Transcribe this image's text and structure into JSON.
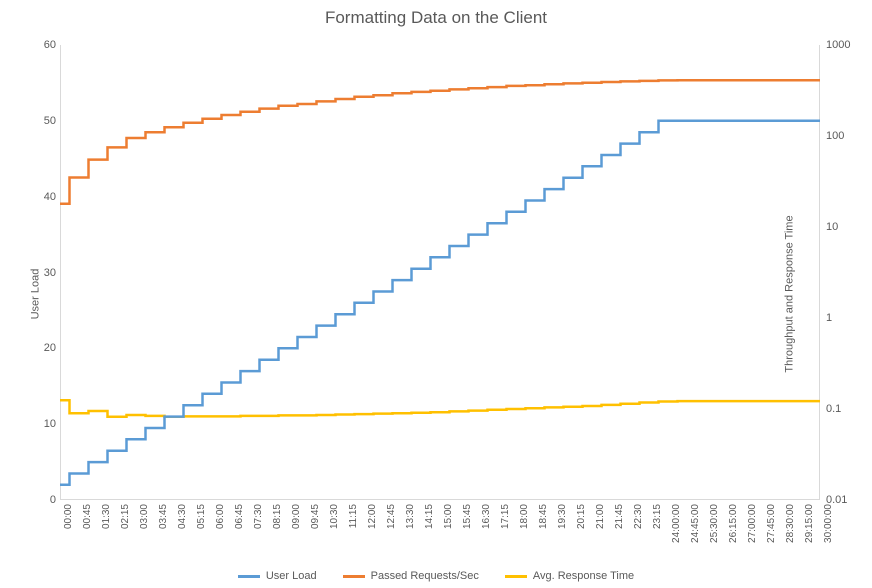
{
  "title": "Formatting Data on the Client",
  "ylabel_left": "User Load",
  "ylabel_right": "Throughput and Response Time",
  "legend": {
    "user_load": "User Load",
    "passed": "Passed Requests/Sec",
    "response": "Avg. Response Time"
  },
  "colors": {
    "user_load": "#5b9bd5",
    "passed": "#ed7d31",
    "response": "#ffc000"
  },
  "left_axis": {
    "min": 0,
    "max": 60,
    "ticks": [
      0,
      10,
      20,
      30,
      40,
      50,
      60
    ]
  },
  "right_axis": {
    "type": "log",
    "min": 0.01,
    "max": 1000,
    "ticks": [
      0.01,
      0.1,
      1,
      10,
      100,
      1000
    ]
  },
  "chart_data": {
    "type": "line",
    "xlabel": "",
    "ylabel": "User Load",
    "ylabel2": "Throughput and Response Time",
    "ylim": [
      0,
      60
    ],
    "ylim2": [
      0.01,
      1000
    ],
    "categories": [
      "00:00",
      "00:45",
      "01:30",
      "02:15",
      "03:00",
      "03:45",
      "04:30",
      "05:15",
      "06:00",
      "06:45",
      "07:30",
      "08:15",
      "09:00",
      "09:45",
      "10:30",
      "11:15",
      "12:00",
      "12:45",
      "13:30",
      "14:15",
      "15:00",
      "15:45",
      "16:30",
      "17:15",
      "18:00",
      "18:45",
      "19:30",
      "20:15",
      "21:00",
      "21:45",
      "22:30",
      "23:15",
      "24:00:00",
      "24:45:00",
      "25:30:00",
      "26:15:00",
      "27:00:00",
      "27:45:00",
      "28:30:00",
      "29:15:00",
      "30:00:00"
    ],
    "series": [
      {
        "name": "User Load",
        "axis": "left",
        "values": [
          2,
          3.5,
          5,
          6.5,
          8,
          9.5,
          11,
          12.5,
          14,
          15.5,
          17,
          18.5,
          20,
          21.5,
          23,
          24.5,
          26,
          27.5,
          29,
          30.5,
          32,
          33.5,
          35,
          36.5,
          38,
          39.5,
          41,
          42.5,
          44,
          45.5,
          47,
          48.5,
          50,
          50,
          50,
          50,
          50,
          50,
          50,
          50,
          50
        ]
      },
      {
        "name": "Passed Requests/Sec",
        "axis": "right",
        "values": [
          18,
          35,
          55,
          75,
          95,
          110,
          125,
          140,
          155,
          170,
          185,
          200,
          215,
          225,
          240,
          255,
          270,
          280,
          295,
          305,
          315,
          325,
          335,
          345,
          355,
          362,
          370,
          378,
          385,
          392,
          398,
          403,
          408,
          410,
          410,
          410,
          410,
          410,
          410,
          410,
          410
        ]
      },
      {
        "name": "Avg. Response Time",
        "axis": "right",
        "values": [
          0.125,
          0.09,
          0.095,
          0.082,
          0.086,
          0.084,
          0.082,
          0.083,
          0.083,
          0.083,
          0.084,
          0.084,
          0.085,
          0.085,
          0.086,
          0.087,
          0.088,
          0.089,
          0.09,
          0.091,
          0.092,
          0.094,
          0.096,
          0.098,
          0.1,
          0.102,
          0.104,
          0.106,
          0.108,
          0.111,
          0.114,
          0.118,
          0.121,
          0.122,
          0.122,
          0.122,
          0.122,
          0.122,
          0.122,
          0.122,
          0.122
        ]
      }
    ],
    "title": "Formatting Data on the Client"
  }
}
